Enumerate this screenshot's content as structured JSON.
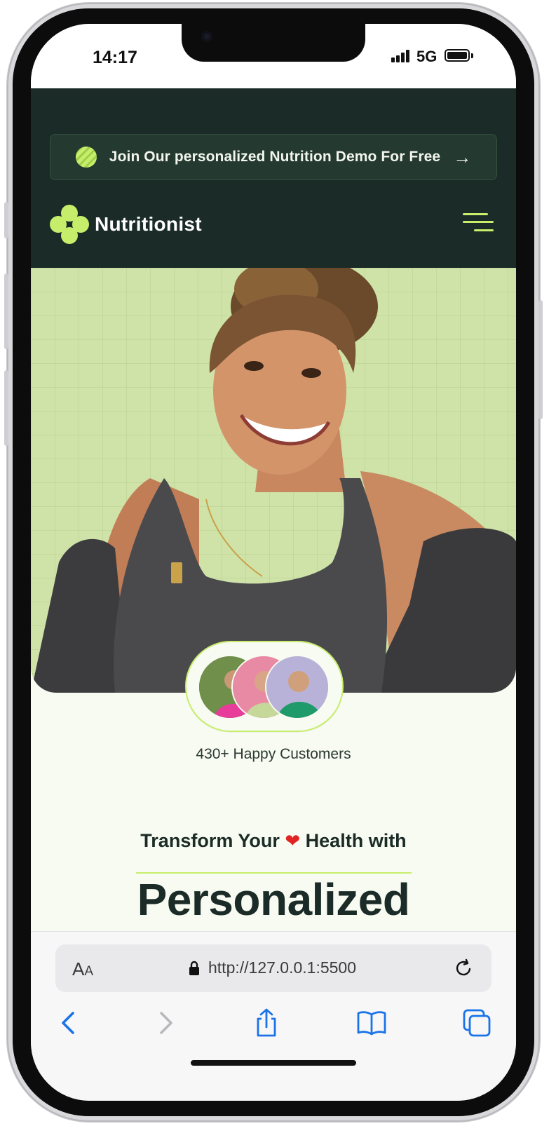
{
  "status_bar": {
    "time": "14:17",
    "network": "5G"
  },
  "promo_banner": {
    "text": "Join Our personalized Nutrition Demo For Free",
    "arrow_icon": "arrow-right-icon"
  },
  "brand": {
    "name": "Nutritionist",
    "accent_color": "#c7ee6b",
    "dark_color": "#1b2b27"
  },
  "hero": {
    "customers_label": "430+ Happy Customers",
    "headline_line1_before": "Transform Your",
    "headline_line1_after": "Health with",
    "headline_line2": "Personalized"
  },
  "browser": {
    "text_size_label": "A",
    "text_size_label_small": "A",
    "url": "http://127.0.0.1:5500"
  }
}
